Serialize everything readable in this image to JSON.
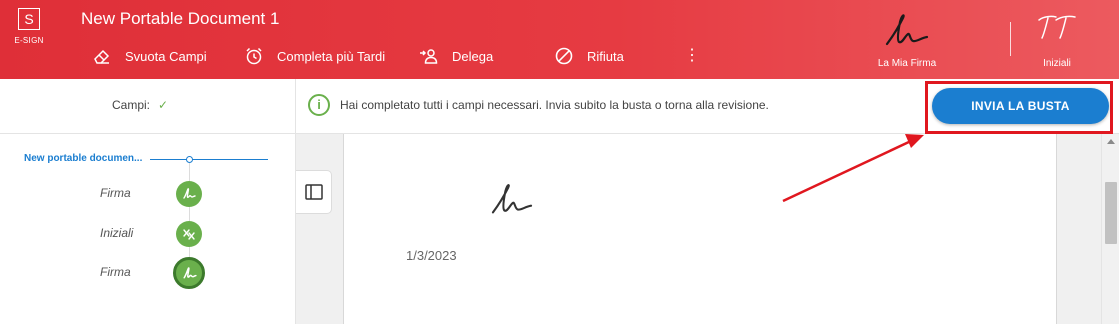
{
  "app": {
    "logo_letter": "S",
    "logo_label": "E-SIGN",
    "document_title": "New Portable Document 1"
  },
  "toolbar": {
    "items": [
      {
        "label": "Svuota Campi",
        "icon": "eraser-icon"
      },
      {
        "label": "Completa più Tardi",
        "icon": "alarm-clock-icon"
      },
      {
        "label": "Delega",
        "icon": "delegate-user-icon"
      },
      {
        "label": "Rifiuta",
        "icon": "block-icon"
      }
    ],
    "more_icon": "⋮"
  },
  "signatures": {
    "my_signature_label": "La Mia Firma",
    "initials_label": "Iniziali"
  },
  "notification": {
    "fields_label": "Campi:",
    "fields_check": "✓",
    "message": "Hai completato tutti i campi necessari. Invia subito la busta o torna alla revisione.",
    "info_icon": "i",
    "send_button": "INVIA LA BUSTA"
  },
  "field_tree": {
    "document_name": "New portable documen...",
    "fields": [
      {
        "label": "Firma",
        "icon": "signature-icon"
      },
      {
        "label": "Iniziali",
        "icon": "initials-icon"
      },
      {
        "label": "Firma",
        "icon": "signature-icon"
      }
    ]
  },
  "page": {
    "date": "1/3/2023"
  },
  "colors": {
    "header_red": "#e63b42",
    "accent_blue": "#1b7ed0",
    "success_green": "#6ab04c",
    "annotation_red": "#e0171f"
  }
}
